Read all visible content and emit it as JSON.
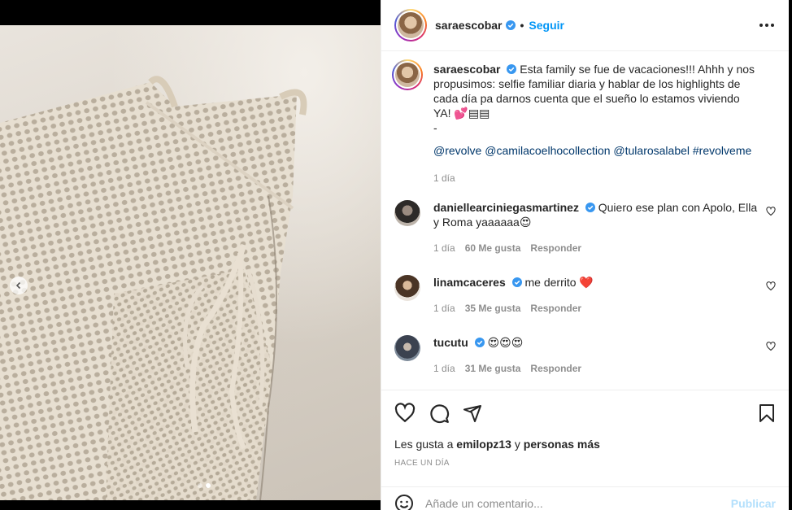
{
  "media": {
    "carousel": {
      "total": 2,
      "active": 1
    },
    "icons": {
      "prev": "chevron-left-icon"
    }
  },
  "post": {
    "author": {
      "username": "saraescobar",
      "verified": true
    },
    "follow_label": "Seguir",
    "separator": "•",
    "caption": {
      "username": "saraescobar",
      "text": "Esta family se fue de vacaciones!!! Ahhh y nos propusimos: selfie familiar diaria y hablar de los highlights de cada día pa darnos cuenta que el sueño lo estamos viviendo YA! 💕▤▤",
      "dash": "-",
      "tags": "@revolve @camilacoelhocollection @tularosalabel #revolveme",
      "time": "1 día"
    },
    "comments": [
      {
        "username": "daniellearciniegasmartinez",
        "text": "Quiero ese plan con Apolo, Ella y Roma yaaaaaa😍",
        "time": "1 día",
        "likes": "60 Me gusta",
        "reply": "Responder"
      },
      {
        "username": "linamcaceres",
        "text": "me derrito ❤️",
        "time": "1 día",
        "likes": "35 Me gusta",
        "reply": "Responder"
      },
      {
        "username": "tucutu",
        "text": "😍😍😍",
        "time": "1 día",
        "likes": "31 Me gusta",
        "reply": "Responder"
      }
    ],
    "likes_line": {
      "prefix": "Les gusta a",
      "user": "emilopz13",
      "connector": "y",
      "others": "personas más"
    },
    "timestamp": "HACE UN DÍA",
    "add_comment": {
      "placeholder": "Añade un comentario...",
      "publish": "Publicar"
    }
  },
  "colors": {
    "accent": "#0095f6",
    "link": "#00376b",
    "muted": "#8e8e8e",
    "publish_disabled": "#b2dffc"
  }
}
